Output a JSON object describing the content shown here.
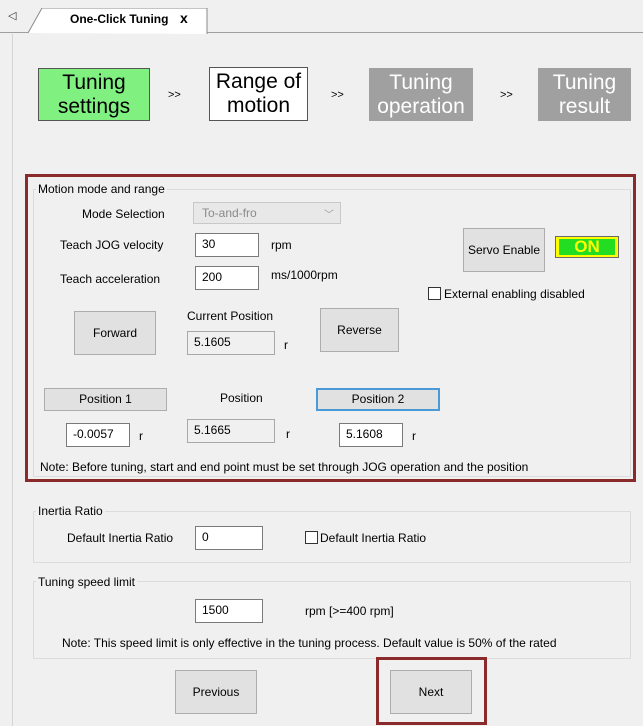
{
  "tab": {
    "arrow": "◁",
    "title": "One-Click Tuning",
    "close": "x"
  },
  "steps": [
    {
      "line1": "Tuning",
      "line2": "settings"
    },
    {
      "line1": "Range of",
      "line2": "motion"
    },
    {
      "line1": "Tuning",
      "line2": "operation"
    },
    {
      "line1": "Tuning",
      "line2": "result"
    }
  ],
  "step_separator": ">>",
  "motion": {
    "title": "Motion mode and range",
    "mode_label": "Mode Selection",
    "mode_value": "To-and-fro",
    "jog_velocity_label": "Teach JOG velocity",
    "jog_velocity_value": "30",
    "jog_velocity_unit": "rpm",
    "accel_label": "Teach acceleration",
    "accel_value": "200",
    "accel_unit": "ms/1000rpm",
    "servo_enable_label": "Servo Enable",
    "servo_status": "ON",
    "external_enable_label": "External enabling disabled",
    "forward_label": "Forward",
    "reverse_label": "Reverse",
    "current_position_label": "Current Position",
    "current_position_value": "5.1605",
    "current_position_unit": "r",
    "position1_label": "Position 1",
    "position_label": "Position",
    "position2_label": "Position 2",
    "position1_value": "-0.0057",
    "position_value": "5.1665",
    "position2_value": "5.1608",
    "unit_r": "r",
    "note": "Note: Before tuning, start  and end point must be set through JOG operation and the position"
  },
  "inertia": {
    "title": "Inertia Ratio",
    "default_label": "Default Inertia Ratio",
    "default_value": "0",
    "checkbox_label": "Default Inertia Ratio"
  },
  "speed_limit": {
    "title": "Tuning speed limit",
    "value": "1500",
    "unit": "rpm   [>=400 rpm]",
    "note": "Note: This speed limit is only effective in the tuning process. Default value is 50% of the rated"
  },
  "buttons": {
    "previous": "Previous",
    "next": "Next"
  },
  "colors": {
    "step_active": "#80f080",
    "step_disabled": "#a0a0a0",
    "highlight": "#8b2a2a",
    "on_bg": "#22dd22",
    "on_text": "#ffff00"
  }
}
